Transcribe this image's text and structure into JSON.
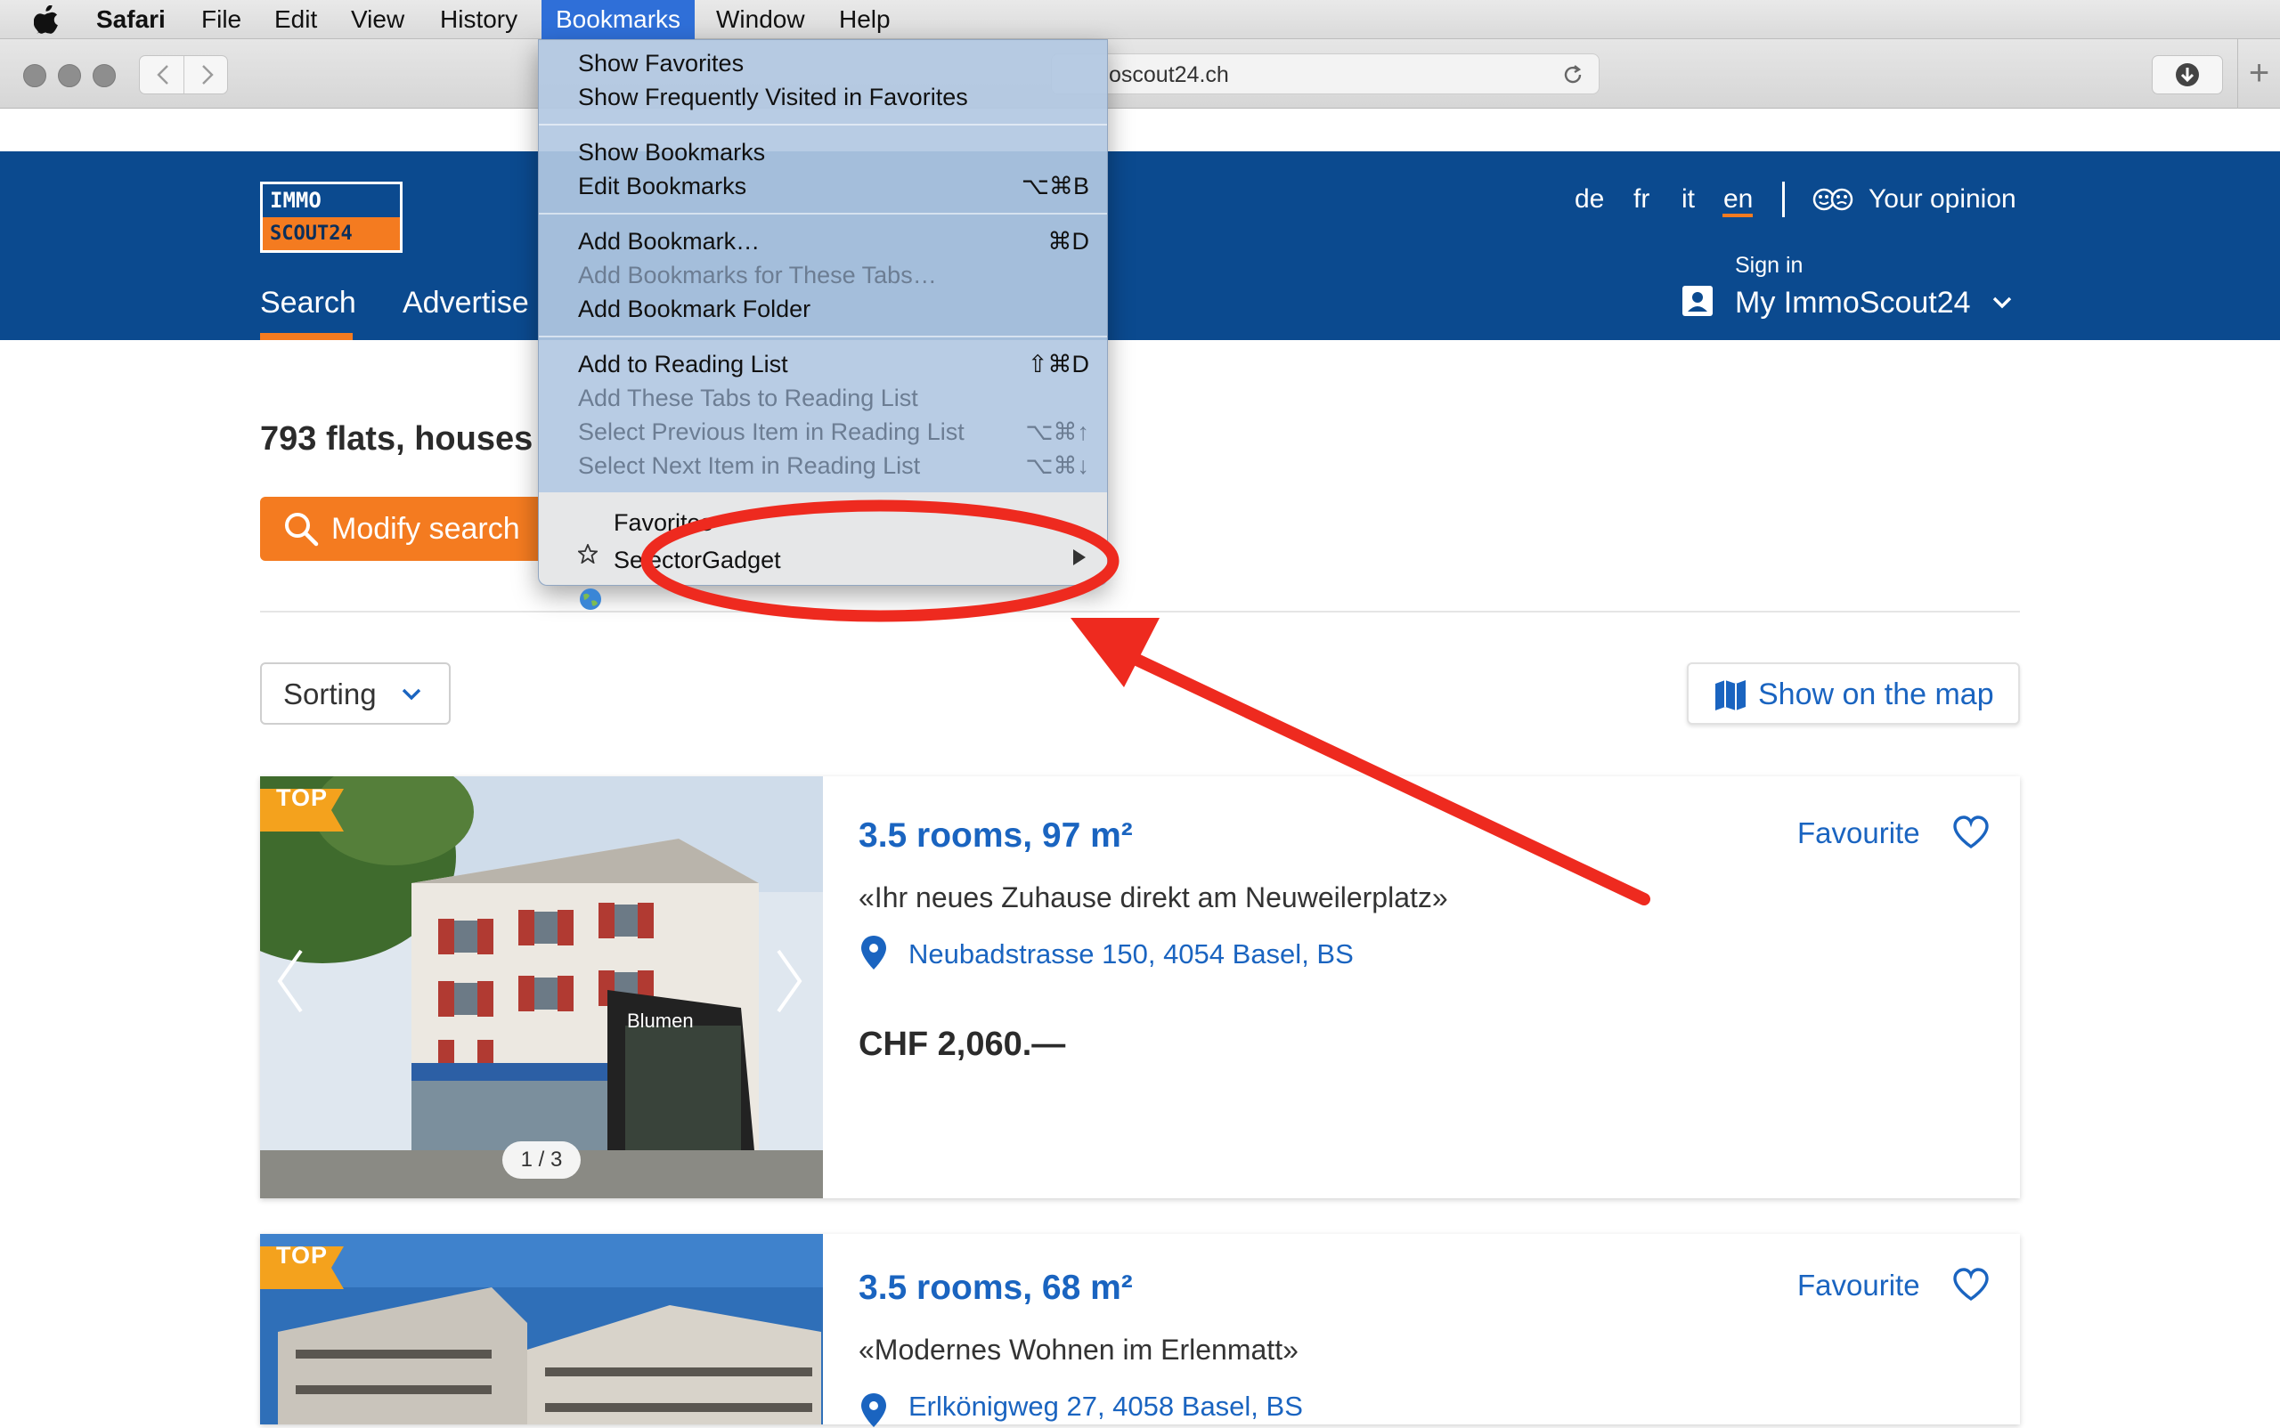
{
  "menubar": {
    "app_name": "Safari",
    "items": [
      "File",
      "Edit",
      "View",
      "History",
      "Bookmarks",
      "Window",
      "Help"
    ],
    "active_item": "Bookmarks"
  },
  "browser": {
    "url_text": "oscout24.ch",
    "new_tab_label": "+"
  },
  "site": {
    "logo_top": "IMMO",
    "logo_bottom": "SCOUT24",
    "nav": {
      "search": "Search",
      "advertise": "Advertise"
    },
    "languages": [
      "de",
      "fr",
      "it",
      "en"
    ],
    "active_language": "en",
    "opinion": "Your opinion",
    "signin_label": "Sign in",
    "account_label": "My ImmoScout24",
    "accent_color": "#f47b20",
    "brand_color": "#0b4a8f",
    "link_color": "#1a64c0"
  },
  "results": {
    "title": "793 flats, houses",
    "modify_button": "Modify search",
    "sorting_label": "Sorting",
    "map_button": "Show on the map"
  },
  "listings": [
    {
      "badge": "TOP",
      "title": "3.5 rooms, 97 m²",
      "subtitle": "«Ihr neues Zuhause direkt am Neuweilerplatz»",
      "address": "Neubadstrasse 150, 4054 Basel, BS",
      "price": "CHF 2,060.—",
      "favourite": "Favourite",
      "image_counter": "1 / 3",
      "image_sign": "Blumen"
    },
    {
      "badge": "TOP",
      "title": "3.5 rooms, 68 m²",
      "subtitle": "«Modernes Wohnen im Erlenmatt»",
      "address": "Erlkönigweg 27, 4058 Basel, BS",
      "favourite": "Favourite"
    }
  ],
  "bookmarks_menu": {
    "groups": [
      [
        {
          "label": "Show Favorites",
          "shortcut": "",
          "enabled": true
        },
        {
          "label": "Show Frequently Visited in Favorites",
          "shortcut": "",
          "enabled": true
        }
      ],
      [
        {
          "label": "Show Bookmarks",
          "shortcut": "",
          "enabled": true
        },
        {
          "label": "Edit Bookmarks",
          "shortcut": "⌥⌘B",
          "enabled": true
        }
      ],
      [
        {
          "label": "Add Bookmark…",
          "shortcut": "⌘D",
          "enabled": true
        },
        {
          "label": "Add Bookmarks for These Tabs…",
          "shortcut": "",
          "enabled": false
        },
        {
          "label": "Add Bookmark Folder",
          "shortcut": "",
          "enabled": true
        }
      ],
      [
        {
          "label": "Add to Reading List",
          "shortcut": "⇧⌘D",
          "enabled": true
        },
        {
          "label": "Add These Tabs to Reading List",
          "shortcut": "",
          "enabled": false
        },
        {
          "label": "Select Previous Item in Reading List",
          "shortcut": "⌥⌘↑",
          "enabled": false
        },
        {
          "label": "Select Next Item in Reading List",
          "shortcut": "⌥⌘↓",
          "enabled": false
        }
      ]
    ],
    "favorites_submenu": "Favorites",
    "bookmark_item": "SelectorGadget"
  },
  "annotation": {
    "color": "#ee2a1f"
  }
}
